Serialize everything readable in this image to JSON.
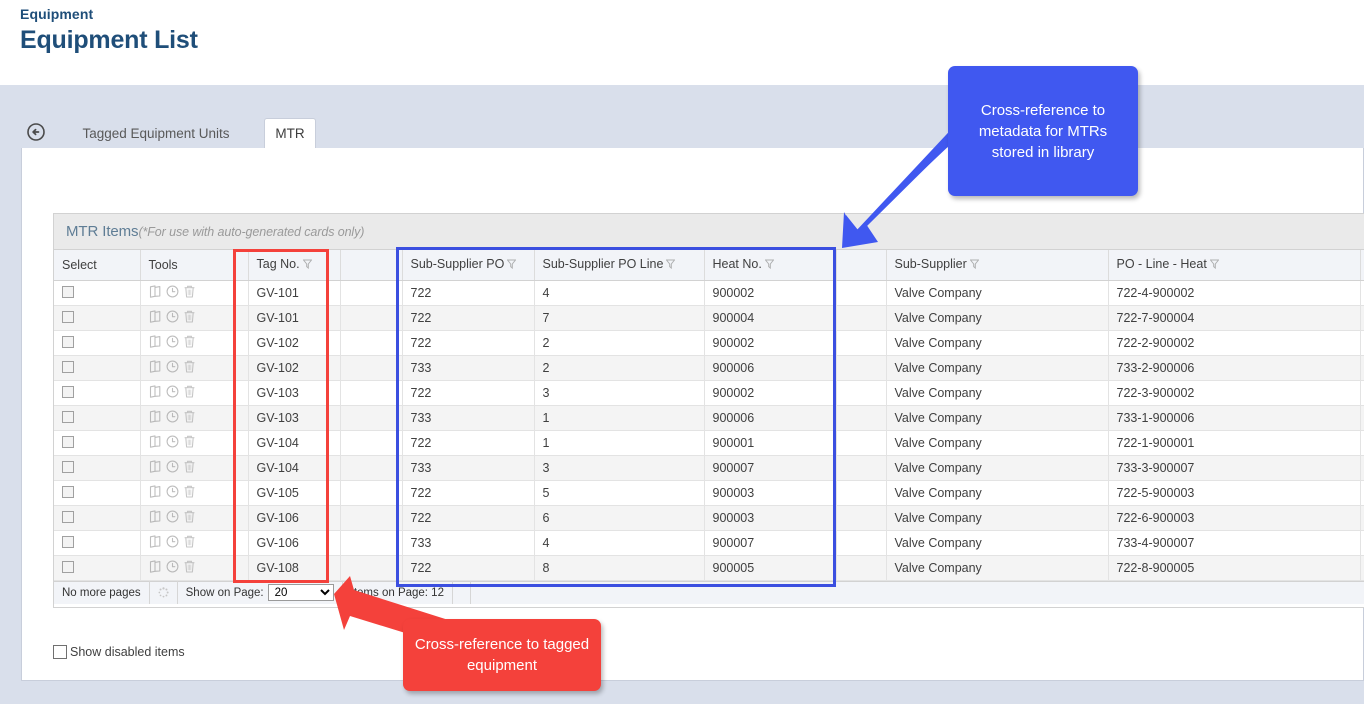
{
  "header": {
    "breadcrumb": "Equipment",
    "title": "Equipment List"
  },
  "tabs": {
    "back_icon": "back-circle-arrow-icon",
    "items": [
      {
        "label": "Tagged Equipment Units",
        "active": false
      },
      {
        "label": "MTR",
        "active": true
      }
    ]
  },
  "grid": {
    "caption_title": "MTR Items",
    "caption_note": "(*For use with auto-generated cards only)",
    "columns": [
      {
        "label": "Select",
        "filter": false
      },
      {
        "label": "Tools",
        "filter": false
      },
      {
        "label": "Tag No.",
        "filter": true
      },
      {
        "label": "",
        "filter": false
      },
      {
        "label": "Sub-Supplier PO",
        "filter": true
      },
      {
        "label": "Sub-Supplier PO Line",
        "filter": true
      },
      {
        "label": "Heat No.",
        "filter": true
      },
      {
        "label": "",
        "filter": false
      },
      {
        "label": "Sub-Supplier",
        "filter": true
      },
      {
        "label": "PO - Line - Heat",
        "filter": true
      },
      {
        "label": "",
        "filter": false
      }
    ],
    "tool_icons": [
      "book-icon",
      "clock-icon",
      "trash-icon"
    ],
    "filter_icon": "funnel-filter-icon",
    "rows": [
      {
        "tag_no": "GV-101",
        "sub_supplier_po": "722",
        "sub_supplier_po_line": "4",
        "heat_no": "900002",
        "sub_supplier": "Valve Company",
        "po_line_heat": "722-4-900002"
      },
      {
        "tag_no": "GV-101",
        "sub_supplier_po": "722",
        "sub_supplier_po_line": "7",
        "heat_no": "900004",
        "sub_supplier": "Valve Company",
        "po_line_heat": "722-7-900004"
      },
      {
        "tag_no": "GV-102",
        "sub_supplier_po": "722",
        "sub_supplier_po_line": "2",
        "heat_no": "900002",
        "sub_supplier": "Valve Company",
        "po_line_heat": "722-2-900002"
      },
      {
        "tag_no": "GV-102",
        "sub_supplier_po": "733",
        "sub_supplier_po_line": "2",
        "heat_no": "900006",
        "sub_supplier": "Valve Company",
        "po_line_heat": "733-2-900006"
      },
      {
        "tag_no": "GV-103",
        "sub_supplier_po": "722",
        "sub_supplier_po_line": "3",
        "heat_no": "900002",
        "sub_supplier": "Valve Company",
        "po_line_heat": "722-3-900002"
      },
      {
        "tag_no": "GV-103",
        "sub_supplier_po": "733",
        "sub_supplier_po_line": "1",
        "heat_no": "900006",
        "sub_supplier": "Valve Company",
        "po_line_heat": "733-1-900006"
      },
      {
        "tag_no": "GV-104",
        "sub_supplier_po": "722",
        "sub_supplier_po_line": "1",
        "heat_no": "900001",
        "sub_supplier": "Valve Company",
        "po_line_heat": "722-1-900001"
      },
      {
        "tag_no": "GV-104",
        "sub_supplier_po": "733",
        "sub_supplier_po_line": "3",
        "heat_no": "900007",
        "sub_supplier": "Valve Company",
        "po_line_heat": "733-3-900007"
      },
      {
        "tag_no": "GV-105",
        "sub_supplier_po": "722",
        "sub_supplier_po_line": "5",
        "heat_no": "900003",
        "sub_supplier": "Valve Company",
        "po_line_heat": "722-5-900003"
      },
      {
        "tag_no": "GV-106",
        "sub_supplier_po": "722",
        "sub_supplier_po_line": "6",
        "heat_no": "900003",
        "sub_supplier": "Valve Company",
        "po_line_heat": "722-6-900003"
      },
      {
        "tag_no": "GV-106",
        "sub_supplier_po": "733",
        "sub_supplier_po_line": "4",
        "heat_no": "900007",
        "sub_supplier": "Valve Company",
        "po_line_heat": "733-4-900007"
      },
      {
        "tag_no": "GV-108",
        "sub_supplier_po": "722",
        "sub_supplier_po_line": "8",
        "heat_no": "900005",
        "sub_supplier": "Valve Company",
        "po_line_heat": "722-8-900005"
      }
    ]
  },
  "footer": {
    "pages_status": "No more pages",
    "refresh_icon": "refresh-spinner-icon",
    "show_on_page_label": "Show on Page:",
    "page_size_value": "20",
    "page_size_options": [
      "20"
    ],
    "items_on_page": "Items on Page: 12"
  },
  "show_disabled": {
    "label": "Show disabled items",
    "checked": false
  },
  "annotations": {
    "blue_callout": "Cross-reference to metadata for MTRs stored in library",
    "red_callout": "Cross-reference to tagged equipment",
    "blue_color": "#3b4fe0",
    "red_color": "#f4413b"
  }
}
